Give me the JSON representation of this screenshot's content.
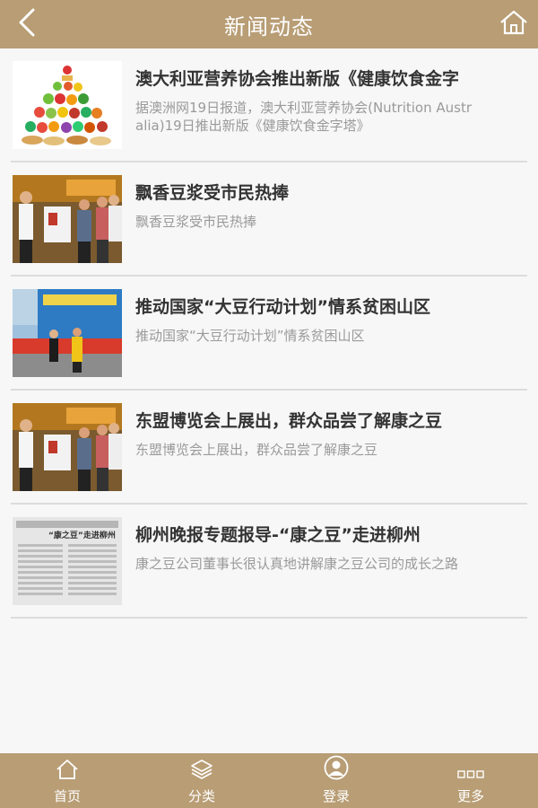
{
  "header": {
    "title": "新闻动态",
    "back_icon": "chevron-left-icon",
    "home_icon": "home-icon"
  },
  "news": [
    {
      "title": "澳大利亚营养协会推出新版《健康饮食金字",
      "summary": "据澳洲网19日报道，澳大利亚营养协会(Nutrition Australia)19日推出新版《健康饮食金字塔》",
      "image": "food-pyramid-image"
    },
    {
      "title": "飘香豆浆受市民热捧",
      "summary": "飘香豆浆受市民热捧",
      "image": "soymilk-event-photo"
    },
    {
      "title": "推动国家“大豆行动计划”情系贫困山区",
      "summary": "推动国家“大豆行动计划”情系贫困山区",
      "image": "soybean-action-plan-photo"
    },
    {
      "title": "东盟博览会上展出，群众品尝了解康之豆",
      "summary": "东盟博览会上展出，群众品尝了解康之豆",
      "image": "asean-expo-photo"
    },
    {
      "title": "柳州晚报专题报导-“康之豆”走进柳州",
      "summary": "康之豆公司董事长很认真地讲解康之豆公司的成长之路",
      "image": "newspaper-clipping-image"
    }
  ],
  "tabbar": {
    "tabs": [
      {
        "label": "首页",
        "icon": "home-icon"
      },
      {
        "label": "分类",
        "icon": "category-icon"
      },
      {
        "label": "登录",
        "icon": "user-icon"
      },
      {
        "label": "更多",
        "icon": "more-icon"
      }
    ]
  },
  "colors": {
    "header_bg": "#b89d75",
    "tabbar_bg": "#b89d75",
    "title_text": "#333333",
    "summary_text": "#9a9a9a"
  },
  "thumbnail_text": {
    "clipping_headline": "“康之豆”走进柳州"
  }
}
